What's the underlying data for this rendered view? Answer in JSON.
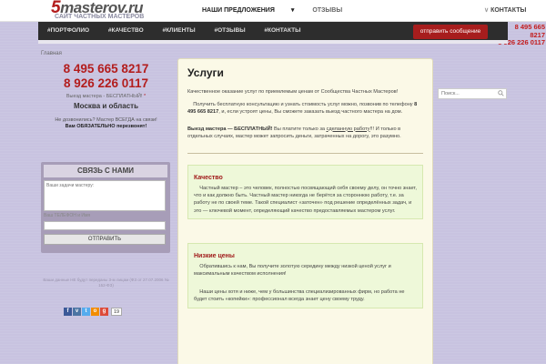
{
  "logo": {
    "main": "masterov.ru",
    "digit": "5",
    "subtitle": "САЙТ ЧАСТНЫХ МАСТЕРОВ"
  },
  "topnav": {
    "offers": "НАШИ ПРЕДЛОЖЕНИЯ",
    "reviews": "ОТЗЫВЫ",
    "contacts": "КОНТАКТЫ"
  },
  "subnav": {
    "items": [
      "#ПОРТФОЛИО",
      "#КАЧЕСТВО",
      "#КЛИЕНТЫ",
      "#ОТЗЫВЫ",
      "#КОНТАКТЫ"
    ],
    "send_button": "отправить сообщение",
    "phone1": "8 495 665 8217",
    "phone2": "8 926 226 0117"
  },
  "breadcrumb": "Главная",
  "left": {
    "phone1": "8 495 665 8217",
    "phone2": "8 926 226 0117",
    "vyezd": "Выезд мастера - БЕСПЛАТНЫЙ!",
    "region": "Москва и область",
    "call_note_1": "Не дозвонились? Мастер ВСЕГДА на связи!",
    "call_note_2": "Вам ОБЯЗАТЕЛЬНО перезвонят!"
  },
  "contact": {
    "title": "СВЯЗЬ С НАМИ",
    "textarea_placeholder": "Ваши задачи мастеру:",
    "input_label": "Ваш ТЕЛЕФОН и Имя",
    "button": "ОТПРАВИТЬ"
  },
  "disclaimer": "Ваши данные НЕ будут переданы 3-м лицам (ФЗ от 27.07.2006 № 152-ФЗ)",
  "social": {
    "count": "19"
  },
  "main": {
    "title": "Услуги",
    "p1": "Качественное оказание услуг по приемлемым ценам от Сообщества Частных Мастеров!",
    "p2_a": "Получить бесплатную консультацию и узнать стоимость услуг можно, позвонив по телефону ",
    "p2_phone": "8 495 665 8217",
    "p2_b": ", и, если устроят цены, Вы сможете заказать выезд частного мастера на дом.",
    "p3_bold": "Выезд мастера — БЕСПЛАТНЫЙ!",
    "p3_a": " Вы платите только за ",
    "p3_under": "сделанную работу",
    "p3_b": "!!! И только в отдельных случаях, мастер может запросить деньги, затраченных на дорогу, это разумно.",
    "quality_title": "Качество",
    "quality_text": "Частный мастер – это человек, полностью посвящающий себя своему делу, он точно знает, что и как должно быть. Частный мастер никогда не берётся за стороннюю работу, т.е. за работу не по своей теме. Такой специалист «заточен» под решение определённых задач, и это — ключевой момент, определяющий качество предоставляемых мастером услуг.",
    "prices_title": "Низкие цены",
    "prices_text_1": "Обратившись к нам, Вы получите золотую середину между низкой ценой услуг и максимальным качеством исполнения!",
    "prices_text_2": "Наши цены хотя и ниже, чем у большинства специализированных фирм, но работа не будет стоить «копейки»: профессионал всегда знает цену своему труду."
  },
  "search": {
    "placeholder": "Поиск..."
  },
  "colors": {
    "accent": "#b31d1d",
    "background": "#c8c3e0",
    "panel": "#fbf9e7",
    "nav": "#2d2d2d"
  }
}
